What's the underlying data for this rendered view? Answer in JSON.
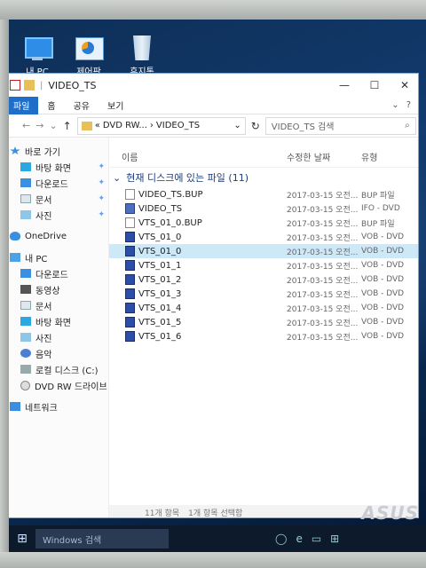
{
  "desktop": {
    "icons": [
      {
        "label": "내 PC",
        "icon": "computer-icon"
      },
      {
        "label": "제어판",
        "icon": "control-panel-icon"
      },
      {
        "label": "휴지통",
        "icon": "recycle-bin-icon"
      }
    ]
  },
  "window": {
    "title": "VIDEO_TS",
    "controls": {
      "minimize": "—",
      "maximize": "☐",
      "close": "✕"
    }
  },
  "ribbon": {
    "file_tab": "파일",
    "tabs": [
      "홈",
      "공유",
      "보기"
    ],
    "expand": "⌄",
    "help": "?"
  },
  "address": {
    "back": "←",
    "forward": "→",
    "recent": "⌄",
    "up": "↑",
    "prefix": "«",
    "path": [
      "DVD RW...",
      "VIDEO_TS"
    ],
    "separator": "›",
    "dropdown": "⌄",
    "refresh": "↻",
    "search_placeholder": "VIDEO_TS 검색",
    "search_icon": "⌕"
  },
  "sidebar": {
    "pin": "✦",
    "quick_access": {
      "label": "바로 가기",
      "icon": "star-icon"
    },
    "quick_items": [
      {
        "label": "바탕 화면",
        "icon": "desktop-icon",
        "pinned": true
      },
      {
        "label": "다운로드",
        "icon": "download-icon",
        "pinned": true
      },
      {
        "label": "문서",
        "icon": "documents-icon",
        "pinned": true
      },
      {
        "label": "사진",
        "icon": "pictures-icon",
        "pinned": true
      }
    ],
    "onedrive": {
      "label": "OneDrive",
      "icon": "onedrive-icon"
    },
    "this_pc": {
      "label": "내 PC",
      "icon": "computer-icon"
    },
    "pc_items": [
      {
        "label": "다운로드",
        "icon": "download-icon"
      },
      {
        "label": "동영상",
        "icon": "videos-icon"
      },
      {
        "label": "문서",
        "icon": "documents-icon"
      },
      {
        "label": "바탕 화면",
        "icon": "desktop-icon"
      },
      {
        "label": "사진",
        "icon": "pictures-icon"
      },
      {
        "label": "음악",
        "icon": "music-icon"
      },
      {
        "label": "로컬 디스크 (C:)",
        "icon": "drive-icon"
      },
      {
        "label": "DVD RW 드라이브",
        "icon": "dvd-drive-icon"
      }
    ],
    "network": {
      "label": "네트워크",
      "icon": "network-icon"
    }
  },
  "columns": {
    "name": "이름",
    "date": "수정한 날짜",
    "type": "유형"
  },
  "group": {
    "label": "현재 디스크에 있는 파일 (11)",
    "chevron": "⌄"
  },
  "files": [
    {
      "name": "VIDEO_TS.BUP",
      "date": "2017-03-15 오전...",
      "type": "BUP 파일",
      "icon": "document-icon"
    },
    {
      "name": "VIDEO_TS",
      "date": "2017-03-15 오전...",
      "type": "IFO - DVD",
      "icon": "ifo-file-icon"
    },
    {
      "name": "VTS_01_0.BUP",
      "date": "2017-03-15 오전...",
      "type": "BUP 파일",
      "icon": "document-icon"
    },
    {
      "name": "VTS_01_0",
      "date": "2017-03-15 오전...",
      "type": "VOB - DVD",
      "icon": "vob-file-icon"
    },
    {
      "name": "VTS_01_0",
      "date": "2017-03-15 오전...",
      "type": "VOB - DVD",
      "icon": "vob-file-icon",
      "selected": true
    },
    {
      "name": "VTS_01_1",
      "date": "2017-03-15 오전...",
      "type": "VOB - DVD",
      "icon": "vob-file-icon"
    },
    {
      "name": "VTS_01_2",
      "date": "2017-03-15 오전...",
      "type": "VOB - DVD",
      "icon": "vob-file-icon"
    },
    {
      "name": "VTS_01_3",
      "date": "2017-03-15 오전...",
      "type": "VOB - DVD",
      "icon": "vob-file-icon"
    },
    {
      "name": "VTS_01_4",
      "date": "2017-03-15 오전...",
      "type": "VOB - DVD",
      "icon": "vob-file-icon"
    },
    {
      "name": "VTS_01_5",
      "date": "2017-03-15 오전...",
      "type": "VOB - DVD",
      "icon": "vob-file-icon"
    },
    {
      "name": "VTS_01_6",
      "date": "2017-03-15 오전...",
      "type": "VOB - DVD",
      "icon": "vob-file-icon"
    }
  ],
  "status": {
    "items": "11개 항목",
    "selected": "1개 항목 선택함"
  },
  "taskbar": {
    "start_glyph": "⊞",
    "search_placeholder": "Windows 검색",
    "apps": [
      "◯",
      "e",
      "▭",
      "⊞"
    ]
  },
  "brand": "ASUS"
}
